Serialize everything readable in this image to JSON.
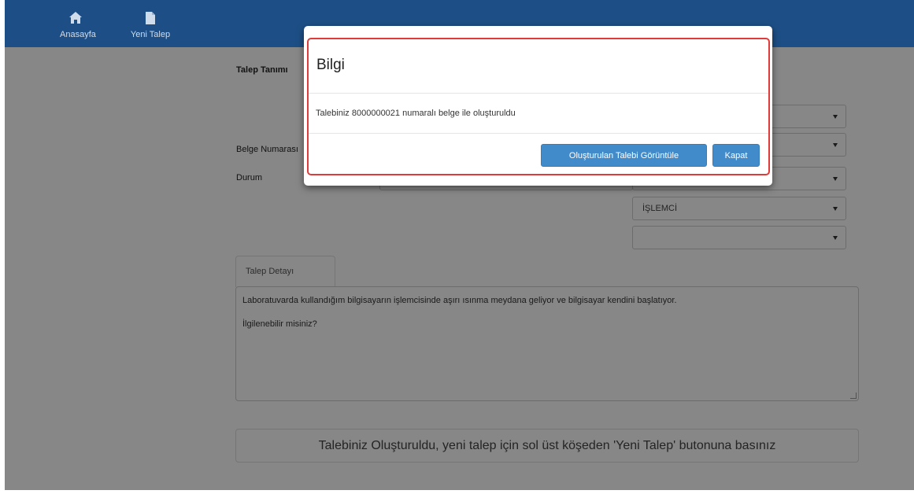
{
  "nav": {
    "home_label": "Anasayfa",
    "new_label": "Yeni Talep"
  },
  "form": {
    "title": "Talep Tanımı",
    "belge_label": "Belge Numarası",
    "durum_label": "Durum",
    "select_islemci": "İŞLEMCİ"
  },
  "detail": {
    "tab_label": "Talep Detayı",
    "line1": "Laboratuvarda kullandığım bilgisayarın işlemcisinde aşırı ısınma meydana geliyor ve bilgisayar kendini başlatıyor.",
    "line2": "İlgilenebilir misiniz?"
  },
  "notice": "Talebiniz Oluşturuldu, yeni talep için sol üst köşeden 'Yeni Talep' butonuna basınız",
  "modal": {
    "title": "Bilgi",
    "message": "Talebiniz 8000000021 numaralı belge ile oluşturuldu",
    "view_button": "Oluşturulan Talebi Görüntüle",
    "close_button": "Kapat"
  },
  "colors": {
    "navbar": "#1d4f86",
    "primary_button": "#428bca",
    "highlight_border": "#e03b3b"
  }
}
